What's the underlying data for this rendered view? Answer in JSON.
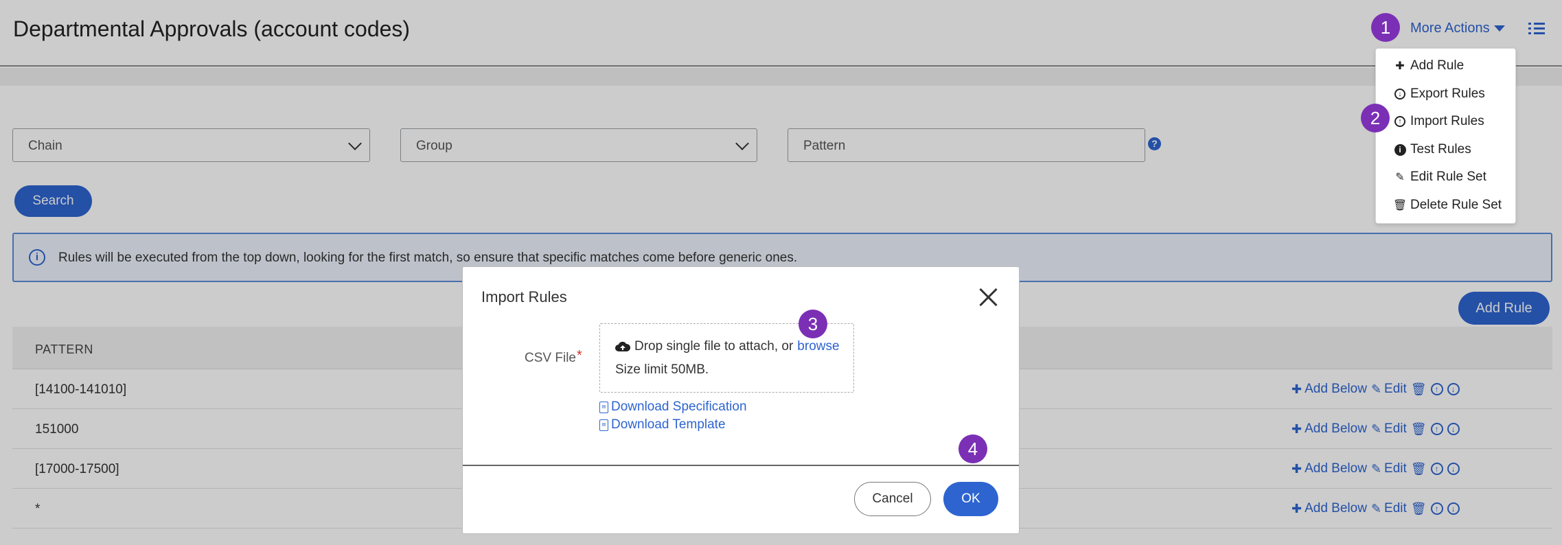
{
  "page": {
    "title": "Departmental Approvals (account codes)"
  },
  "header": {
    "more_actions_label": "More Actions"
  },
  "filters": {
    "chain_label": "Chain",
    "group_label": "Group",
    "pattern_placeholder": "Pattern",
    "help_glyph": "?"
  },
  "search_label": "Search",
  "info": {
    "icon_glyph": "i",
    "text": "Rules will be executed from the top down, looking for the first match, so ensure that specific matches come before generic ones."
  },
  "add_rule_label": "Add Rule",
  "table": {
    "column_pattern": "PATTERN",
    "rows": [
      {
        "pattern": "[14100-141010]"
      },
      {
        "pattern": "151000"
      },
      {
        "pattern": "[17000-17500]"
      },
      {
        "pattern": "*"
      }
    ],
    "add_below_label": "Add Below",
    "edit_label": "Edit"
  },
  "menu": {
    "items": [
      {
        "label": "Add Rule",
        "icon": "plus-icon"
      },
      {
        "label": "Export Rules",
        "icon": "circle-arrow-down-icon"
      },
      {
        "label": "Import Rules",
        "icon": "circle-arrow-up-icon"
      },
      {
        "label": "Test Rules",
        "icon": "info-circle-icon"
      },
      {
        "label": "Edit Rule Set",
        "icon": "pencil-icon"
      },
      {
        "label": "Delete Rule Set",
        "icon": "trash-icon"
      }
    ]
  },
  "modal": {
    "title": "Import Rules",
    "csv_label": "CSV File",
    "required_mark": "*",
    "drop_text": "Drop single file to attach, or",
    "browse_label": "browse",
    "size_limit": "Size limit 50MB.",
    "download_spec_label": "Download Specification",
    "download_template_label": "Download Template",
    "cancel_label": "Cancel",
    "ok_label": "OK"
  },
  "markers": [
    "1",
    "2",
    "3",
    "4"
  ],
  "colors": {
    "accent": "#2e64d0",
    "marker": "#7b2fb5",
    "required": "#d9302c"
  }
}
